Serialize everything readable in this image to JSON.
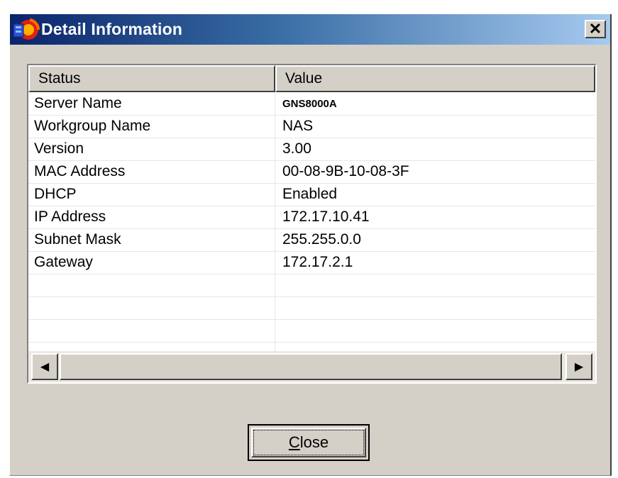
{
  "window": {
    "title": "Detail Information",
    "close_glyph": "✕"
  },
  "table": {
    "headers": [
      "Status",
      "Value"
    ],
    "rows": [
      {
        "status": "Server Name",
        "value": "GNS8000A"
      },
      {
        "status": "Workgroup Name",
        "value": "NAS"
      },
      {
        "status": "Version",
        "value": "3.00"
      },
      {
        "status": "MAC Address",
        "value": "00-08-9B-10-08-3F"
      },
      {
        "status": "DHCP",
        "value": "Enabled"
      },
      {
        "status": "IP Address",
        "value": "172.17.10.41"
      },
      {
        "status": "Subnet Mask",
        "value": "255.255.0.0"
      },
      {
        "status": "Gateway",
        "value": "172.17.2.1"
      },
      {
        "status": "",
        "value": ""
      },
      {
        "status": "",
        "value": ""
      },
      {
        "status": "",
        "value": ""
      }
    ]
  },
  "scrollbar": {
    "left_arrow": "◀",
    "right_arrow": "▶"
  },
  "buttons": {
    "close_mnemonic": "C",
    "close_rest": "lose"
  },
  "icons": {
    "app": "nas-app-icon",
    "close": "close-icon"
  },
  "colors": {
    "title_start": "#0a246a",
    "title_end": "#a6caf0",
    "face": "#d4d0c8"
  }
}
